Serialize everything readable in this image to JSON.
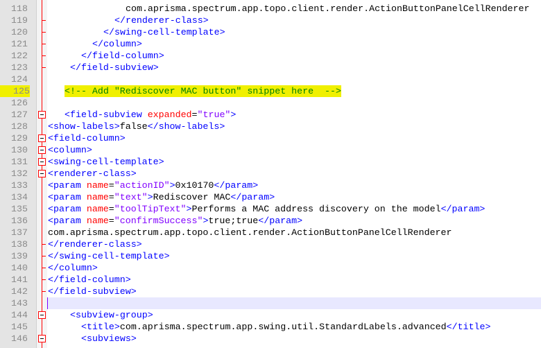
{
  "editor": {
    "lines": [
      {
        "n": "118",
        "indent": 14,
        "tokens": [
          {
            "t": "com.aprisma.spectrum.app.topo.client.render.ActionButtonPanelCellRenderer",
            "c": "x"
          }
        ]
      },
      {
        "n": "119",
        "indent": 12,
        "fold": "tick",
        "tokens": [
          {
            "t": "</renderer-class>",
            "c": "t"
          }
        ]
      },
      {
        "n": "120",
        "indent": 10,
        "fold": "tick",
        "tokens": [
          {
            "t": "</swing-cell-template>",
            "c": "t"
          }
        ]
      },
      {
        "n": "121",
        "indent": 8,
        "fold": "tick",
        "tokens": [
          {
            "t": "</column>",
            "c": "t"
          }
        ]
      },
      {
        "n": "122",
        "indent": 6,
        "fold": "tick",
        "tokens": [
          {
            "t": "</field-column>",
            "c": "t"
          }
        ]
      },
      {
        "n": "123",
        "indent": 4,
        "fold": "tick",
        "tokens": [
          {
            "t": "</field-subview>",
            "c": "t"
          }
        ]
      },
      {
        "n": "124",
        "indent": 0,
        "tokens": []
      },
      {
        "n": "125",
        "indent": 3,
        "highlight": true,
        "tokens": [
          {
            "t": "<!-- Add \"Rediscover MAC button\" snippet here  -->",
            "c": "c"
          }
        ]
      },
      {
        "n": "126",
        "indent": 0,
        "tokens": []
      },
      {
        "n": "127",
        "indent": 3,
        "fold": "box",
        "tokens": [
          {
            "t": "<field-subview ",
            "c": "t"
          },
          {
            "t": "expanded",
            "c": "a"
          },
          {
            "t": "=",
            "c": "x"
          },
          {
            "t": "\"true\"",
            "c": "v"
          },
          {
            "t": ">",
            "c": "t"
          }
        ]
      },
      {
        "n": "128",
        "indent": 0,
        "tokens": [
          {
            "t": "<show-labels>",
            "c": "t"
          },
          {
            "t": "false",
            "c": "x"
          },
          {
            "t": "</show-labels>",
            "c": "t"
          }
        ]
      },
      {
        "n": "129",
        "indent": 0,
        "fold": "box",
        "tokens": [
          {
            "t": "<field-column>",
            "c": "t"
          }
        ]
      },
      {
        "n": "130",
        "indent": 0,
        "fold": "box",
        "tokens": [
          {
            "t": "<column>",
            "c": "t"
          }
        ]
      },
      {
        "n": "131",
        "indent": 0,
        "fold": "box",
        "tokens": [
          {
            "t": "<swing-cell-template>",
            "c": "t"
          }
        ]
      },
      {
        "n": "132",
        "indent": 0,
        "fold": "box",
        "tokens": [
          {
            "t": "<renderer-class>",
            "c": "t"
          }
        ]
      },
      {
        "n": "133",
        "indent": 0,
        "tokens": [
          {
            "t": "<param ",
            "c": "t"
          },
          {
            "t": "name",
            "c": "a"
          },
          {
            "t": "=",
            "c": "x"
          },
          {
            "t": "\"actionID\"",
            "c": "v"
          },
          {
            "t": ">",
            "c": "t"
          },
          {
            "t": "0x10170",
            "c": "x"
          },
          {
            "t": "</param>",
            "c": "t"
          }
        ]
      },
      {
        "n": "134",
        "indent": 0,
        "tokens": [
          {
            "t": "<param ",
            "c": "t"
          },
          {
            "t": "name",
            "c": "a"
          },
          {
            "t": "=",
            "c": "x"
          },
          {
            "t": "\"text\"",
            "c": "v"
          },
          {
            "t": ">",
            "c": "t"
          },
          {
            "t": "Rediscover MAC",
            "c": "x"
          },
          {
            "t": "</param>",
            "c": "t"
          }
        ]
      },
      {
        "n": "135",
        "indent": 0,
        "tokens": [
          {
            "t": "<param ",
            "c": "t"
          },
          {
            "t": "name",
            "c": "a"
          },
          {
            "t": "=",
            "c": "x"
          },
          {
            "t": "\"toolTipText\"",
            "c": "v"
          },
          {
            "t": ">",
            "c": "t"
          },
          {
            "t": "Performs a MAC address discovery on the model",
            "c": "x"
          },
          {
            "t": "</param>",
            "c": "t"
          }
        ]
      },
      {
        "n": "136",
        "indent": 0,
        "tokens": [
          {
            "t": "<param ",
            "c": "t"
          },
          {
            "t": "name",
            "c": "a"
          },
          {
            "t": "=",
            "c": "x"
          },
          {
            "t": "\"confirmSuccess\"",
            "c": "v"
          },
          {
            "t": ">",
            "c": "t"
          },
          {
            "t": "true;true",
            "c": "x"
          },
          {
            "t": "</param>",
            "c": "t"
          }
        ]
      },
      {
        "n": "137",
        "indent": 0,
        "tokens": [
          {
            "t": "com.aprisma.spectrum.app.topo.client.render.ActionButtonPanelCellRenderer",
            "c": "x"
          }
        ]
      },
      {
        "n": "138",
        "indent": 0,
        "fold": "tick",
        "tokens": [
          {
            "t": "</renderer-class>",
            "c": "t"
          }
        ]
      },
      {
        "n": "139",
        "indent": 0,
        "fold": "tick",
        "tokens": [
          {
            "t": "</swing-cell-template>",
            "c": "t"
          }
        ]
      },
      {
        "n": "140",
        "indent": 0,
        "fold": "tick",
        "tokens": [
          {
            "t": "</column>",
            "c": "t"
          }
        ]
      },
      {
        "n": "141",
        "indent": 0,
        "fold": "tick",
        "tokens": [
          {
            "t": "</field-column>",
            "c": "t"
          }
        ]
      },
      {
        "n": "142",
        "indent": 0,
        "fold": "tick",
        "tokens": [
          {
            "t": "</field-subview>",
            "c": "t"
          }
        ]
      },
      {
        "n": "143",
        "indent": 0,
        "current": true,
        "tokens": []
      },
      {
        "n": "144",
        "indent": 4,
        "fold": "box",
        "tokens": [
          {
            "t": "<subview-group>",
            "c": "t"
          }
        ]
      },
      {
        "n": "145",
        "indent": 6,
        "tokens": [
          {
            "t": "<title>",
            "c": "t"
          },
          {
            "t": "com.aprisma.spectrum.app.swing.util.StandardLabels.advanced",
            "c": "x"
          },
          {
            "t": "</title>",
            "c": "t"
          }
        ]
      },
      {
        "n": "146",
        "indent": 6,
        "fold": "box",
        "tokens": [
          {
            "t": "<subviews>",
            "c": "t"
          }
        ]
      }
    ]
  }
}
